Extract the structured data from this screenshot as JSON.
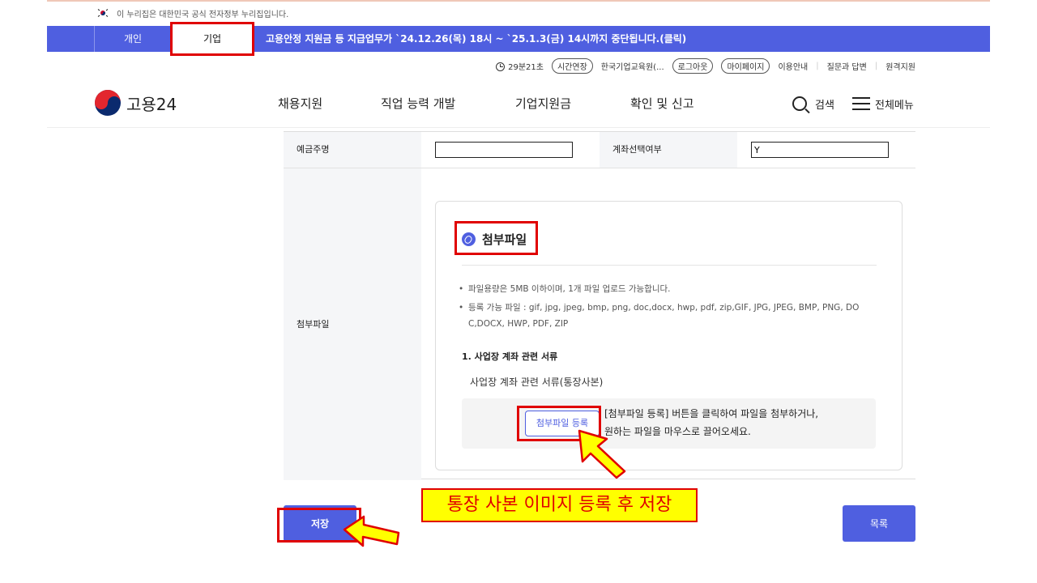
{
  "gov_banner": {
    "text": "이 누리집은 대한민국 공식 전자정부 누리집입니다."
  },
  "user_tabs": {
    "personal": "개인",
    "business": "기업"
  },
  "notice": {
    "text": "고용안정 지원금 등 지급업무가 `24.12.26(목) 18시 ~ `25.1.3(금) 14시까지 중단됩니다.(클릭)"
  },
  "utility": {
    "timer": "29분21초",
    "extend_label": "시간연장",
    "org_name": "한국기업교육원(...",
    "logout_label": "로그아웃",
    "mypage_label": "마이페이지",
    "links": [
      "이용안내",
      "질문과 답변",
      "원격지원"
    ]
  },
  "header": {
    "logo_text": "고용24",
    "nav": [
      "채용지원",
      "직업 능력 개발",
      "기업지원금",
      "확인 및 신고"
    ],
    "search_label": "검색",
    "menu_label": "전체메뉴"
  },
  "form": {
    "depositor_label": "예금주명",
    "depositor_value": "",
    "account_select_label": "계좌선택여부",
    "account_select_value": "Y",
    "attachment_label": "첨부파일"
  },
  "attachment": {
    "title": "첨부파일",
    "guide_1": "파일용량은 5MB 이하이며, 1개 파일 업로드 가능합니다.",
    "guide_2a": "등록 가능 파일 : gif, jpg, jpeg, bmp, png, doc,docx, hwp, pdf, zip,GIF, JPG, JPEG, BMP, PNG, DO",
    "guide_2b": "C,DOCX, HWP, PDF, ZIP",
    "bullet": "•",
    "section_title": "1. 사업장 계좌 관련 서류",
    "section_sub": "사업장 계좌 관련 서류(통장사본)",
    "button_label": "첨부파일 등록",
    "drop_line_1": "[첨부파일 등록] 버튼을 클릭하여 파일을 첨부하거나,",
    "drop_line_2": "원하는 파일을 마우스로 끌어오세요."
  },
  "buttons": {
    "save": "저장",
    "list": "목록"
  },
  "annotation": {
    "callout": "통장 사본 이미지 등록 후 저장"
  },
  "colors": {
    "brand": "#4f5fe0",
    "highlight_red": "#e00000",
    "callout_yellow": "#ffff00"
  }
}
